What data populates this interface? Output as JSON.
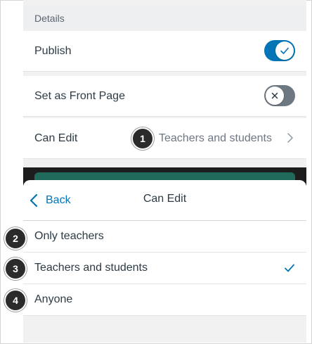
{
  "details": {
    "section_label": "Details",
    "publish": {
      "label": "Publish",
      "on": true
    },
    "front_page": {
      "label": "Set as Front Page",
      "on": false
    },
    "can_edit": {
      "label": "Can Edit",
      "value": "Teachers and students"
    }
  },
  "sheet": {
    "back_label": "Back",
    "title": "Can Edit",
    "options": [
      {
        "label": "Only teachers",
        "selected": false
      },
      {
        "label": "Teachers and students",
        "selected": true
      },
      {
        "label": "Anyone",
        "selected": false
      }
    ]
  },
  "callouts": [
    "1",
    "2",
    "3",
    "4"
  ],
  "colors": {
    "accent": "#0374b5",
    "toggle_off": "#6e7882",
    "text": "#2d3b45"
  }
}
